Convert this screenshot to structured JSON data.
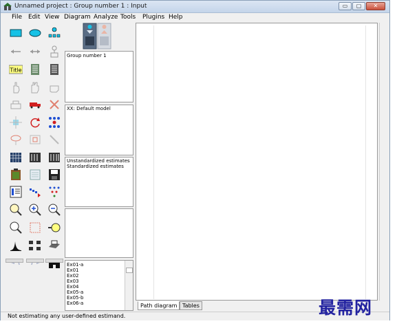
{
  "window": {
    "title": "Unnamed project : Group number 1 : Input",
    "controls": {
      "minimize": "▭",
      "restore": "▢",
      "close": "✕"
    }
  },
  "menu": [
    "File",
    "Edit",
    "View",
    "Diagram",
    "Analyze",
    "Tools",
    "Plugins",
    "Help"
  ],
  "panels": {
    "groups": {
      "items": [
        "Group number 1"
      ]
    },
    "models": {
      "items": [
        "XX: Default model"
      ]
    },
    "estimates": {
      "items": [
        "Unstandardized estimates",
        "Standardized estimates"
      ]
    }
  },
  "variables": [
    "Ex01-a",
    "Ex01",
    "Ex02",
    "Ex03",
    "Ex04",
    "Ex05-a",
    "Ex05-b",
    "Ex06-a"
  ],
  "tabs": {
    "path_diagram": "Path diagram",
    "tables": "Tables"
  },
  "toolbox": {
    "title_tool_label": "Title"
  },
  "status": "Not estimating any user-defined estimand.",
  "watermark": "最需网",
  "colors": {
    "accent_cyan": "#16c2e6",
    "title_yellow": "#ffff80",
    "red": "#d21f1f"
  }
}
